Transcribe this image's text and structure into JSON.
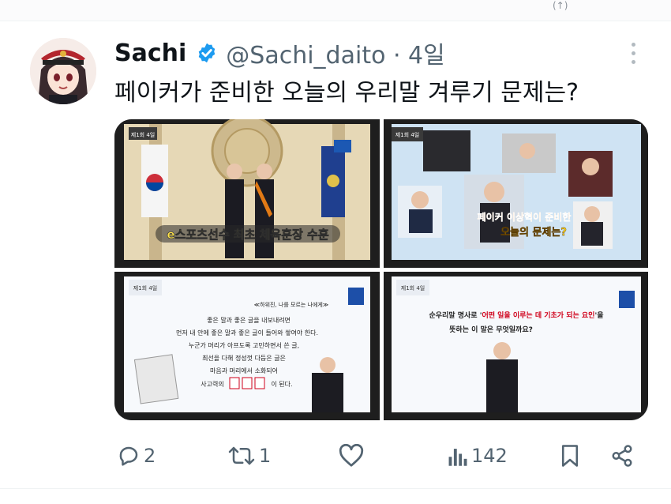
{
  "status_bar": {
    "glyph": "(↑)"
  },
  "tweet": {
    "author_name": "Sachi",
    "handle_time": "@Sachi_daito · 4일",
    "text": "페이커가 준비한 오늘의 우리말 겨루기 문제는?"
  },
  "media": {
    "image1": {
      "episode": "제1회 4일",
      "caption": "e스포츠선수 최초 체육훈장 수훈"
    },
    "image2": {
      "episode": "제1회 4일",
      "caption_top": "페이커 이상혁이 준비한",
      "caption_bottom": "오늘의 문제는?"
    },
    "image3": {
      "episode": "제1회 4일",
      "source": "≪하위진, 나를 모르는 나에게≫",
      "lines": [
        "좋은 말과 좋은 글을 내보내려면",
        "먼저 내 안에 좋은 말과 좋은 글이 들어와 쌓여야 한다.",
        "누군가 머리가 아프도록 고민하면서 쓴 글,",
        "최선을 다해 정성껏 다듬은 글은",
        "마음과 머리에서 소화되어"
      ],
      "last_prefix": "사고력의",
      "last_suffix": "이 된다."
    },
    "image4": {
      "episode": "제1회 4일",
      "line1_prefix": "순우리말 명사로 '",
      "line1_highlight": "어떤 일을 이루는 데 기초가 되는 요인",
      "line1_suffix": "'을",
      "line2": "뜻하는 이 말은 무엇일까요?"
    }
  },
  "actions": {
    "reply_count": "2",
    "retweet_count": "1",
    "views_count": "142"
  },
  "icons": {
    "reply": "reply-icon",
    "retweet": "retweet-icon",
    "like": "heart-icon",
    "views": "views-icon",
    "bookmark": "bookmark-icon",
    "share": "share-icon",
    "verified": "verified-badge-icon",
    "more": "more-icon"
  },
  "colors": {
    "verified": "#1d9bf0",
    "secondary_text": "#536471",
    "highlight_red": "#d0021b"
  }
}
